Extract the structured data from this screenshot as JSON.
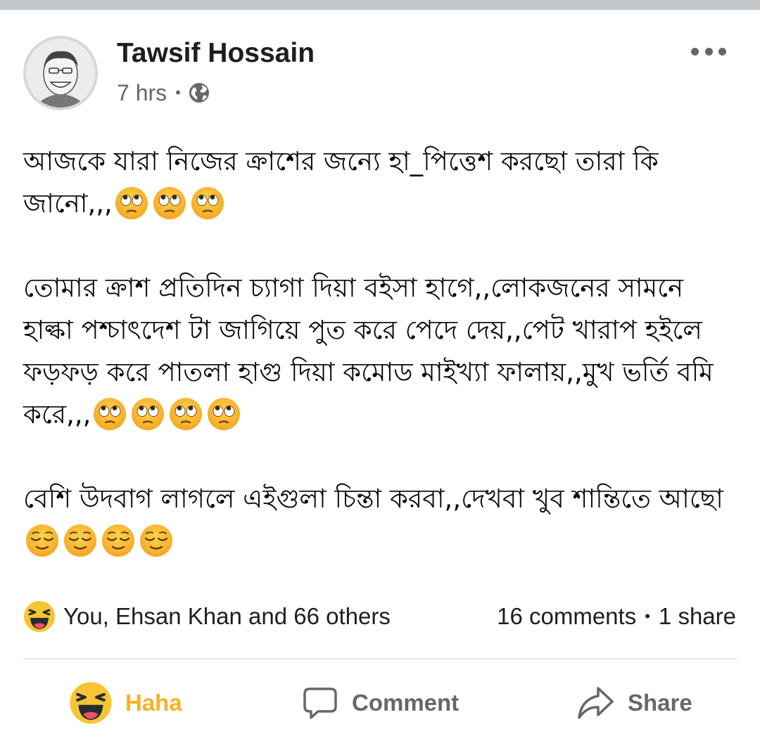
{
  "post": {
    "author": "Tawsif Hossain",
    "time": "7 hrs",
    "meta_separator": "•",
    "privacy_icon": "globe-icon",
    "more_icon": "more-options-icon",
    "paragraphs": [
      {
        "text": "আজকে যারা নিজের ক্রাশের জন্যে হা_পিত্তেশ করছো তারা কি জানো,,,",
        "trailing_emoji": {
          "name": "face-with-rolling-eyes",
          "count": 3
        }
      },
      {
        "text": "তোমার ক্রাশ প্রতিদিন চ্যাগা দিয়া বইসা হাগে,,লোকজনের সামনে হাল্কা পশ্চাৎদেশ টা জাগিয়ে পুত করে পেদে দেয়,,পেট খারাপ হইলে ফড়ফড় করে পাতলা হাগু দিয়া কমোড মাইখ্যা ফালায়,,মুখ ভর্তি বমি করে,,,",
        "trailing_emoji": {
          "name": "face-with-rolling-eyes",
          "count": 4
        }
      },
      {
        "text": "বেশি উদবাগ লাগলে এইগুলা চিন্তা করবা,,দেখবা খুব শান্তিতে আছো",
        "trailing_emoji": {
          "name": "relieved-face",
          "count": 4
        }
      }
    ]
  },
  "reactions": {
    "icon": "haha-reaction-icon",
    "summary": "You, Ehsan Khan and 66 others",
    "comments": "16 comments",
    "separator": "•",
    "shares": "1 share"
  },
  "actions": {
    "haha_label": "Haha",
    "comment_label": "Comment",
    "share_label": "Share"
  },
  "colors": {
    "haha": "#f7b125",
    "secondary_text": "#65676b",
    "divider": "#e4e6eb",
    "top_strip": "#c4c7cc"
  }
}
